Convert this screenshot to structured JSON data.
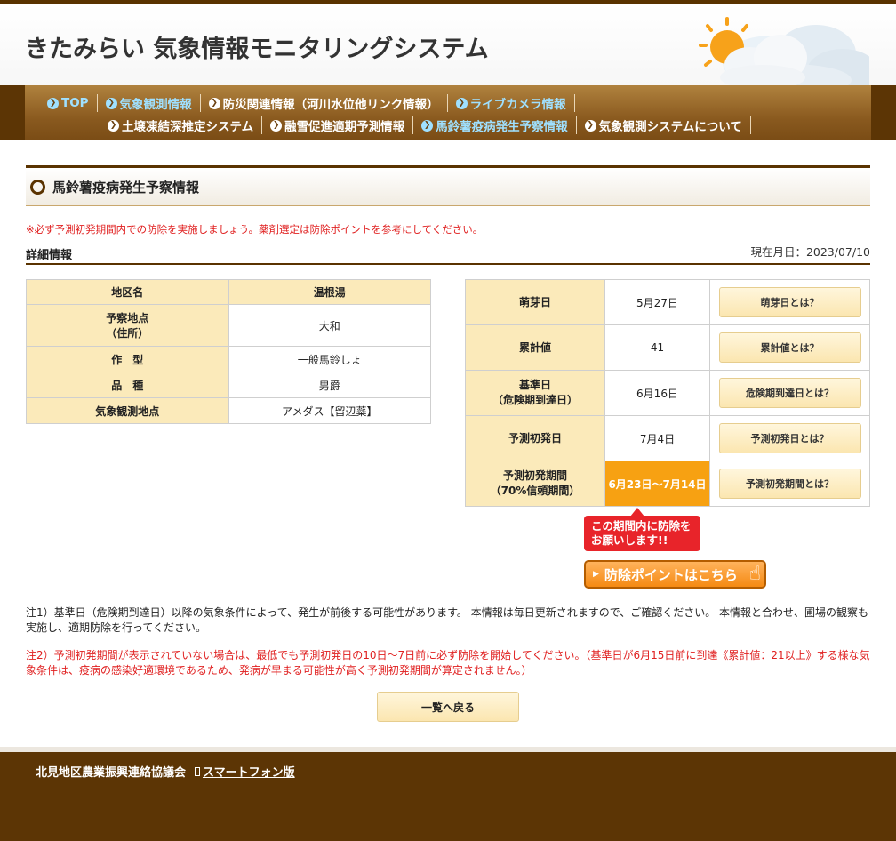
{
  "site": {
    "title": "きたみらい 気象情報モニタリングシステム"
  },
  "nav": {
    "row1": [
      {
        "label": "TOP",
        "blue": true
      },
      {
        "label": "気象観測情報",
        "blue": true
      },
      {
        "label": "防災関連情報（河川水位他リンク情報）",
        "blue": false
      },
      {
        "label": "ライブカメラ情報",
        "blue": true
      }
    ],
    "row2": [
      {
        "label": "土壌凍結深推定システム",
        "blue": false
      },
      {
        "label": "融雪促進適期予測情報",
        "blue": false
      },
      {
        "label": "馬鈴薯疫病発生予察情報",
        "blue": true
      },
      {
        "label": "気象観測システムについて",
        "blue": false
      }
    ]
  },
  "section": {
    "title": "馬鈴薯疫病発生予察情報"
  },
  "warning": "※必ず予測初発期間内での防除を実施しましょう。薬剤選定は防除ポイントを参考にしてください。",
  "detail": {
    "title": "詳細情報",
    "date": "現在月日：2023/07/10"
  },
  "left_table": [
    {
      "label": "地区名",
      "value": "温根湯",
      "header": true
    },
    {
      "label": "予察地点\n（住所）",
      "value": "大和"
    },
    {
      "label": "作　型",
      "value": "一般馬鈴しょ"
    },
    {
      "label": "品　種",
      "value": "男爵"
    },
    {
      "label": "気象観測地点",
      "value": "アメダス【留辺蘂】"
    }
  ],
  "right_table": [
    {
      "label": "萌芽日",
      "value": "5月27日",
      "button": "萌芽日とは？"
    },
    {
      "label": "累計値",
      "value": "41",
      "button": "累計値とは？"
    },
    {
      "label": "基準日\n（危険期到達日）",
      "value": "6月16日",
      "button": "危険期到達日とは？"
    },
    {
      "label": "予測初発日",
      "value": "7月4日",
      "button": "予測初発日とは？"
    },
    {
      "label": "予測初発期間\n（70%信頼期間）",
      "value": "6月23日～7月14日",
      "button": "予測初発期間とは？",
      "highlight": true
    }
  ],
  "bubble": {
    "line1": "この期間内に防除を",
    "line2": "お願いします!!"
  },
  "point_button": "防除ポイントはこちら",
  "note1": "注1）基準日（危険期到達日）以降の気象条件によって、発生が前後する可能性があります。 本情報は毎日更新されますので、ご確認ください。 本情報と合わせ、圃場の観察も実施し、適期防除を行ってください。",
  "note2": "注2）予測初発期間が表示されていない場合は、最低でも予測初発日の10日～7日前に必ず防除を開始してください。（基準日が6月15日前に到達《累計値：21以上》する様な気象条件は、疫病の感染好適環境であるため、発病が早まる可能性が高く予測初発期間が算定されません。）",
  "back_button": "一覧へ戻る",
  "footer": {
    "org": "北見地区農業振興連絡協議会",
    "smartphone": "スマートフォン版"
  },
  "colors": {
    "brown": "#5c3505",
    "nav": "#8a5a1f",
    "cream": "#fbeaba",
    "orange": "#f7a112",
    "red": "#e8242a"
  }
}
